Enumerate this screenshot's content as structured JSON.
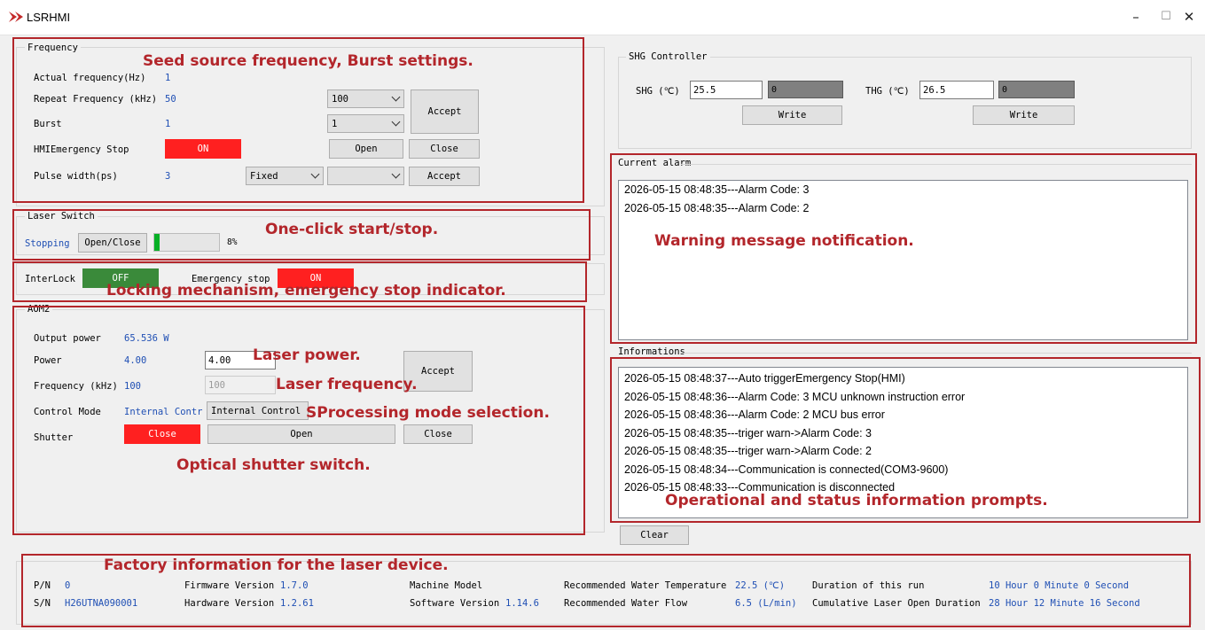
{
  "window": {
    "title": "LSRHMI",
    "minimize": "–",
    "maximize": "☐",
    "close": "✕"
  },
  "frequency": {
    "group_title": "Frequency",
    "actual_label": "Actual frequency(Hz)",
    "actual_value": "1",
    "repeat_label": "Repeat Frequency (kHz)",
    "repeat_value": "50",
    "repeat_combo": "100",
    "burst_label": "Burst",
    "burst_value": "1",
    "burst_combo": "1",
    "accept_label": "Accept",
    "hmi_stop_label": "HMIEmergency Stop",
    "hmi_stop_state": "ON",
    "open_label": "Open",
    "close_label": "Close",
    "pulse_label": "Pulse width(ps)",
    "pulse_value": "3",
    "pulse_mode_combo": "Fixed",
    "pulse_combo": "",
    "pulse_accept_label": "Accept"
  },
  "laser_switch": {
    "group_title": "Laser Switch",
    "status": "Stopping",
    "button": "Open/Close",
    "progress": 0.08,
    "progress_text": "8%"
  },
  "interlock": {
    "label": "InterLock",
    "state": "OFF",
    "estop_label": "Emergency stop",
    "estop_state": "ON"
  },
  "aom": {
    "group_title": "AOM2",
    "output_power_label": "Output power",
    "output_power_value": "65.536 W",
    "power_label": "Power",
    "power_value": "4.00",
    "power_input": "4.00",
    "freq_label": "Frequency (kHz)",
    "freq_value": "100",
    "freq_input": "100",
    "accept_label": "Accept",
    "control_mode_label": "Control Mode",
    "control_mode_value": "Internal Contr",
    "control_mode_combo": "Internal Control",
    "shutter_label": "Shutter",
    "shutter_state": "Close",
    "shutter_open": "Open",
    "shutter_close": "Close"
  },
  "shg": {
    "group_title": "SHG Controller",
    "shg_label": "SHG (℃)",
    "shg_input": "25.5",
    "shg_readout": "0",
    "shg_write": "Write",
    "thg_label": "THG (℃)",
    "thg_input": "26.5",
    "thg_readout": "0",
    "thg_write": "Write"
  },
  "alarm": {
    "group_title": "Current alarm",
    "lines": [
      "2026-05-15 08:48:35---Alarm Code: 3",
      "2026-05-15 08:48:35---Alarm Code: 2"
    ]
  },
  "info": {
    "group_title": "Informations",
    "lines": [
      "2026-05-15 08:48:37---Auto triggerEmergency Stop(HMI)",
      "2026-05-15 08:48:36---Alarm Code: 3 MCU unknown instruction error",
      "2026-05-15 08:48:36---Alarm Code: 2 MCU bus error",
      "2026-05-15 08:48:35---triger warn->Alarm Code: 3",
      "2026-05-15 08:48:35---triger warn->Alarm Code: 2",
      "2026-05-15 08:48:34---Communication is connected(COM3-9600)",
      "2026-05-15 08:48:33---Communication is disconnected"
    ],
    "clear_label": "Clear"
  },
  "factory": {
    "pn_label": "P/N",
    "pn_value": "0",
    "sn_label": "S/N",
    "sn_value": "H26UTNA090001",
    "fw_label": "Firmware Version",
    "fw_value": "1.7.0",
    "hw_label": "Hardware Version",
    "hw_value": "1.2.61",
    "model_label": "Machine Model",
    "model_value": "",
    "sw_label": "Software Version",
    "sw_value": "1.14.6",
    "water_temp_label": "Recommended Water Temperature",
    "water_temp_value": "22.5 (℃)",
    "water_flow_label": "Recommended Water Flow",
    "water_flow_value": "6.5 (L/min)",
    "duration_label": "Duration of this run",
    "duration_value": "10 Hour 0 Minute 0 Second",
    "cumulative_label": "Cumulative Laser Open Duration",
    "cumulative_value": "28 Hour 12 Minute 16 Second"
  },
  "annotations": {
    "seed": "Seed source frequency, Burst settings.",
    "oneclick": "One-click start/stop.",
    "locking": "Locking mechanism, emergency stop indicator.",
    "laser_power": "Laser power.",
    "laser_freq": "Laser frequency.",
    "processing": "SProcessing mode selection.",
    "shutter": "Optical shutter switch.",
    "warning": "Warning message notification.",
    "operational": "Operational and status information prompts.",
    "factory": "Factory information for the laser device."
  },
  "colors": {
    "indicator_red": "#ff2020",
    "indicator_green": "#3a8a3a",
    "annotation": "#b3262b",
    "value_blue": "#1f4fb4"
  }
}
